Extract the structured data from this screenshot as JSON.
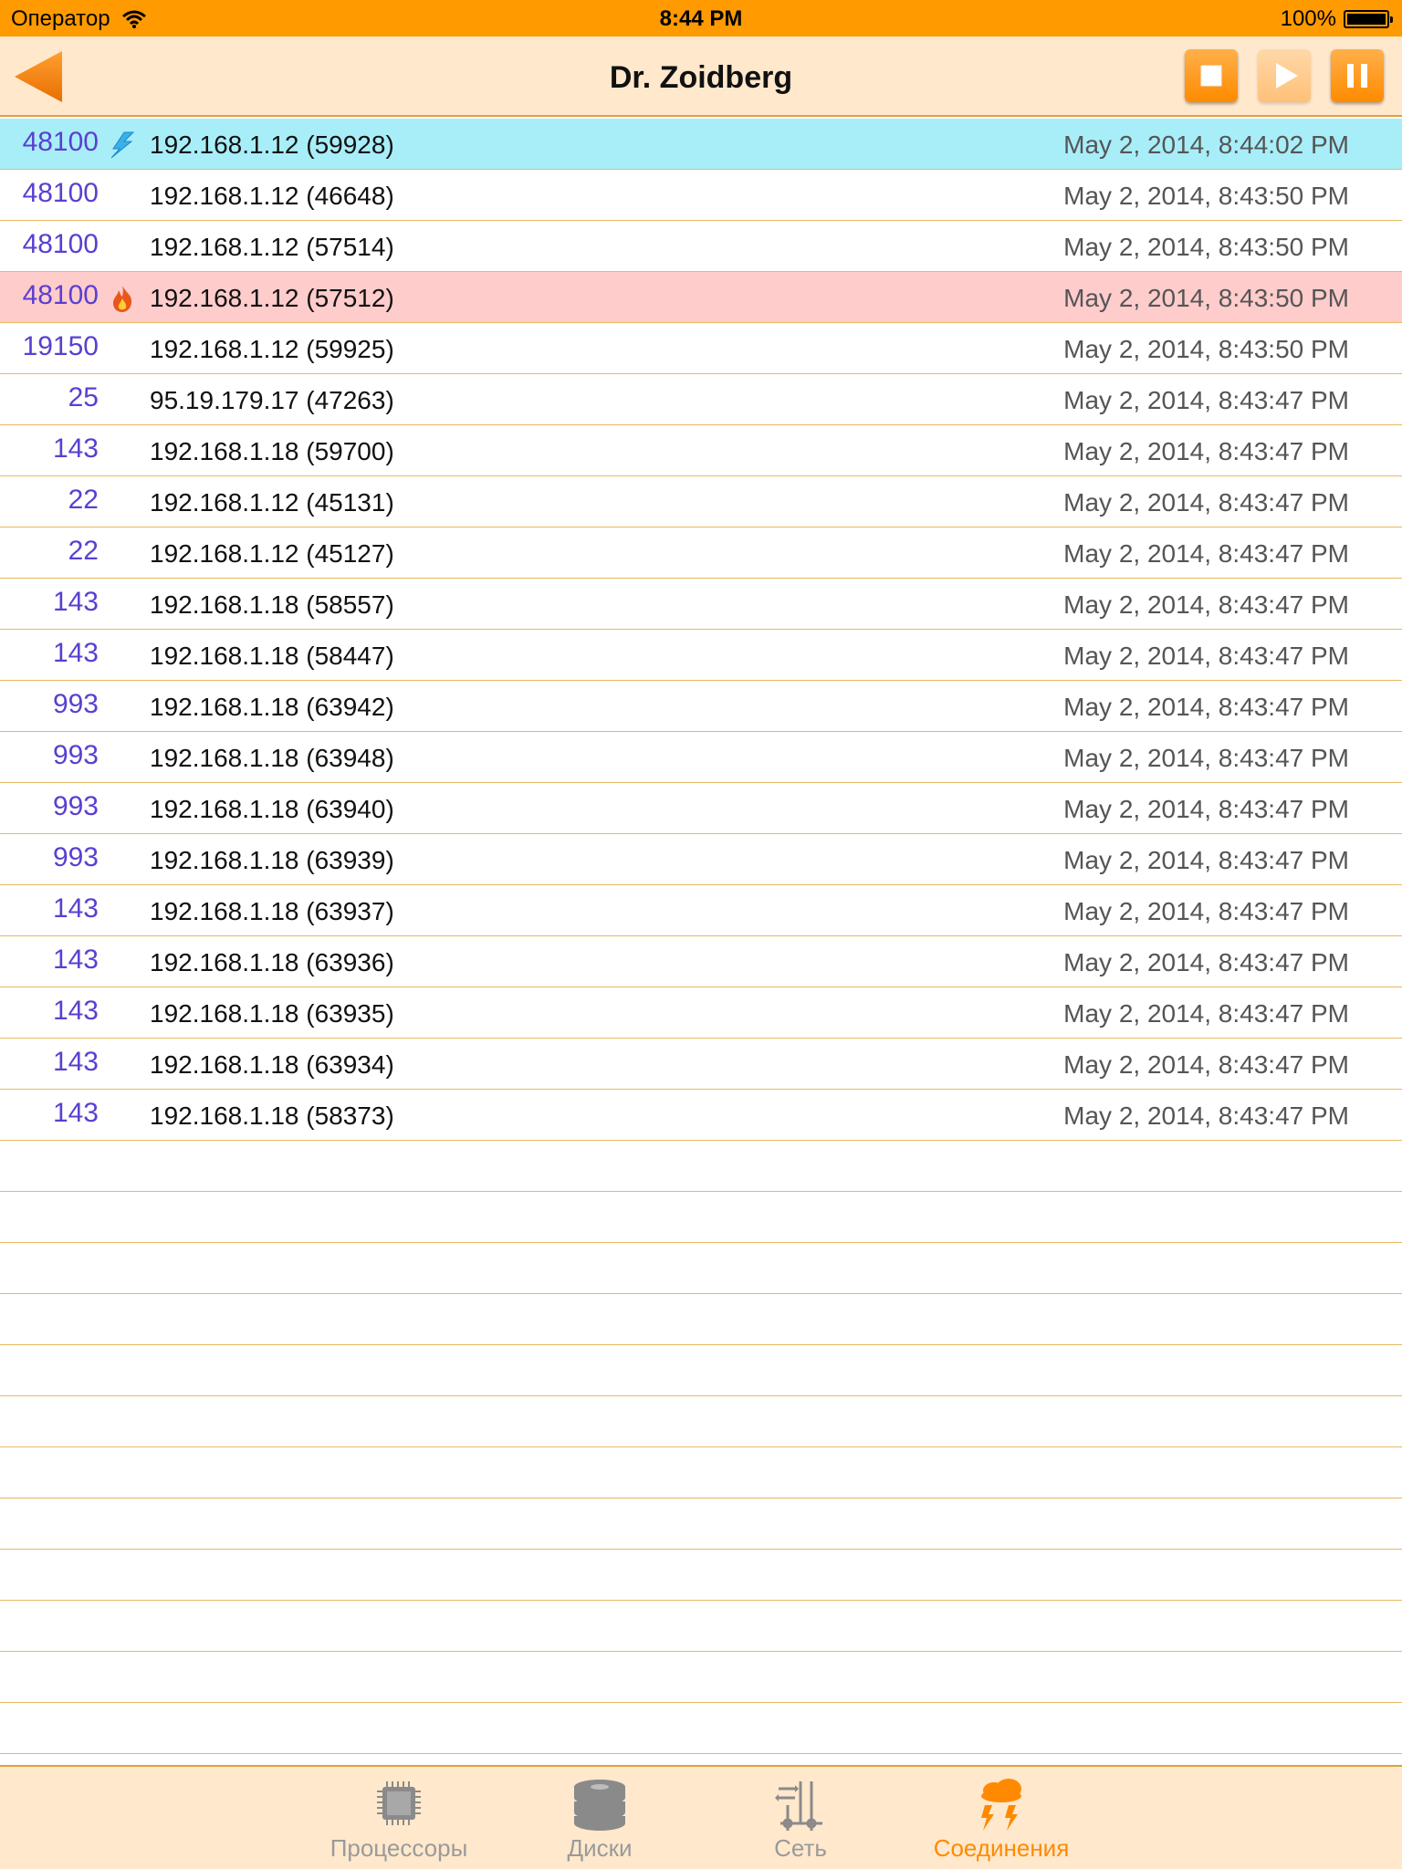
{
  "status_bar": {
    "carrier": "Оператор",
    "time": "8:44 PM",
    "battery": "100%",
    "battery_level": 1.0
  },
  "nav": {
    "title": "Dr. Zoidberg",
    "back_icon": "back-arrow-icon",
    "stop_icon": "stop-icon",
    "play_icon": "play-icon",
    "pause_icon": "pause-icon"
  },
  "connections": [
    {
      "port": "48100",
      "icon": "lightning-icon",
      "address": "192.168.1.12 (59928)",
      "time": "May 2, 2014, 8:44:02 PM",
      "highlight": "blue"
    },
    {
      "port": "48100",
      "icon": "",
      "address": "192.168.1.12 (46648)",
      "time": "May 2, 2014, 8:43:50 PM",
      "highlight": ""
    },
    {
      "port": "48100",
      "icon": "",
      "address": "192.168.1.12 (57514)",
      "time": "May 2, 2014, 8:43:50 PM",
      "highlight": ""
    },
    {
      "port": "48100",
      "icon": "fire-icon",
      "address": "192.168.1.12 (57512)",
      "time": "May 2, 2014, 8:43:50 PM",
      "highlight": "red"
    },
    {
      "port": "19150",
      "icon": "",
      "address": "192.168.1.12 (59925)",
      "time": "May 2, 2014, 8:43:50 PM",
      "highlight": ""
    },
    {
      "port": "25",
      "icon": "",
      "address": "95.19.179.17 (47263)",
      "time": "May 2, 2014, 8:43:47 PM",
      "highlight": ""
    },
    {
      "port": "143",
      "icon": "",
      "address": "192.168.1.18 (59700)",
      "time": "May 2, 2014, 8:43:47 PM",
      "highlight": ""
    },
    {
      "port": "22",
      "icon": "",
      "address": "192.168.1.12 (45131)",
      "time": "May 2, 2014, 8:43:47 PM",
      "highlight": ""
    },
    {
      "port": "22",
      "icon": "",
      "address": "192.168.1.12 (45127)",
      "time": "May 2, 2014, 8:43:47 PM",
      "highlight": ""
    },
    {
      "port": "143",
      "icon": "",
      "address": "192.168.1.18 (58557)",
      "time": "May 2, 2014, 8:43:47 PM",
      "highlight": ""
    },
    {
      "port": "143",
      "icon": "",
      "address": "192.168.1.18 (58447)",
      "time": "May 2, 2014, 8:43:47 PM",
      "highlight": ""
    },
    {
      "port": "993",
      "icon": "",
      "address": "192.168.1.18 (63942)",
      "time": "May 2, 2014, 8:43:47 PM",
      "highlight": ""
    },
    {
      "port": "993",
      "icon": "",
      "address": "192.168.1.18 (63948)",
      "time": "May 2, 2014, 8:43:47 PM",
      "highlight": ""
    },
    {
      "port": "993",
      "icon": "",
      "address": "192.168.1.18 (63940)",
      "time": "May 2, 2014, 8:43:47 PM",
      "highlight": ""
    },
    {
      "port": "993",
      "icon": "",
      "address": "192.168.1.18 (63939)",
      "time": "May 2, 2014, 8:43:47 PM",
      "highlight": ""
    },
    {
      "port": "143",
      "icon": "",
      "address": "192.168.1.18 (63937)",
      "time": "May 2, 2014, 8:43:47 PM",
      "highlight": ""
    },
    {
      "port": "143",
      "icon": "",
      "address": "192.168.1.18 (63936)",
      "time": "May 2, 2014, 8:43:47 PM",
      "highlight": ""
    },
    {
      "port": "143",
      "icon": "",
      "address": "192.168.1.18 (63935)",
      "time": "May 2, 2014, 8:43:47 PM",
      "highlight": ""
    },
    {
      "port": "143",
      "icon": "",
      "address": "192.168.1.18 (63934)",
      "time": "May 2, 2014, 8:43:47 PM",
      "highlight": ""
    },
    {
      "port": "143",
      "icon": "",
      "address": "192.168.1.18 (58373)",
      "time": "May 2, 2014, 8:43:47 PM",
      "highlight": ""
    }
  ],
  "tabs": [
    {
      "label": "Процессоры",
      "icon": "cpu-chip-icon",
      "active": false
    },
    {
      "label": "Диски",
      "icon": "disk-stack-icon",
      "active": false
    },
    {
      "label": "Сеть",
      "icon": "network-sliders-icon",
      "active": false
    },
    {
      "label": "Соединения",
      "icon": "storm-cloud-icon",
      "active": true
    }
  ],
  "colors": {
    "accent": "#ff9a00",
    "bar_background": "#ffe8cc",
    "port_text": "#5a3fd1",
    "highlight_blue": "#a8eef9",
    "highlight_red": "#ffcccc"
  }
}
